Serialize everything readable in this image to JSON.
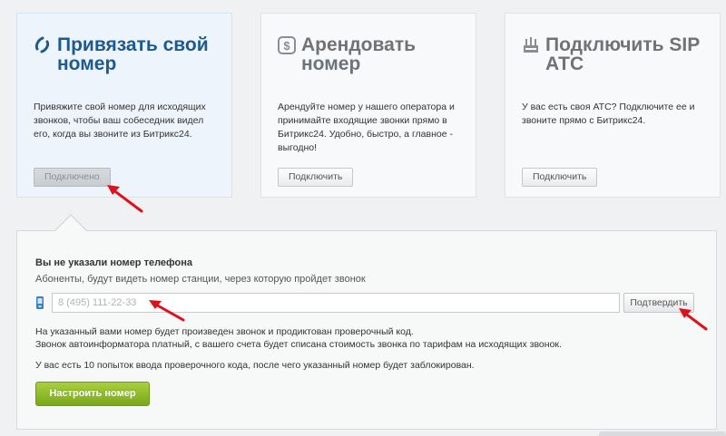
{
  "cards": [
    {
      "icon": "phone-link-icon",
      "title": "Привязать свой\nномер",
      "description": "Привяжите свой номер для исходящих звонков, чтобы ваш собеседник видел его, когда вы звоните из Битрикс24.",
      "button": "Подключено",
      "state": "active"
    },
    {
      "icon": "rent-dollar-icon",
      "title": "Арендовать\nномер",
      "description": "Арендуйте номер у нашего оператора и принимайте входящие звонки прямо в Битрикс24. Удобно, быстро, а главное - выгодно!",
      "button": "Подключить",
      "state": "inactive"
    },
    {
      "icon": "sip-pbx-icon",
      "title": "Подключить SIP\nАТС",
      "description": "У вас есть своя АТС? Подключите ее и звоните прямо с Битрикс24.",
      "button": "Подключить",
      "state": "inactive"
    }
  ],
  "panel": {
    "title": "Вы не указали номер телефона",
    "subtitle": "Абоненты, будут видеть номер станции, через которую пройдет звонок",
    "phone_placeholder": "8 (495) 111-22-33",
    "confirm_button": "Подтвердить",
    "info_line1": "На указанный вами номер будет произведен звонок и продиктован проверочный код.",
    "info_line2": "Звонок автоинформатора платный, с вашего счета будет списана стоимость звонка по тарифам на исходящих звонок.",
    "attempts_note": "У вас есть 10 попыток ввода проверочного кода, после чего указанный номер будет заблокирован.",
    "setup_button": "Настроить номер"
  },
  "colors": {
    "accent": "#1d5a8e",
    "annotation_arrow": "#e0101a",
    "green_button": "#8cbb2a"
  }
}
